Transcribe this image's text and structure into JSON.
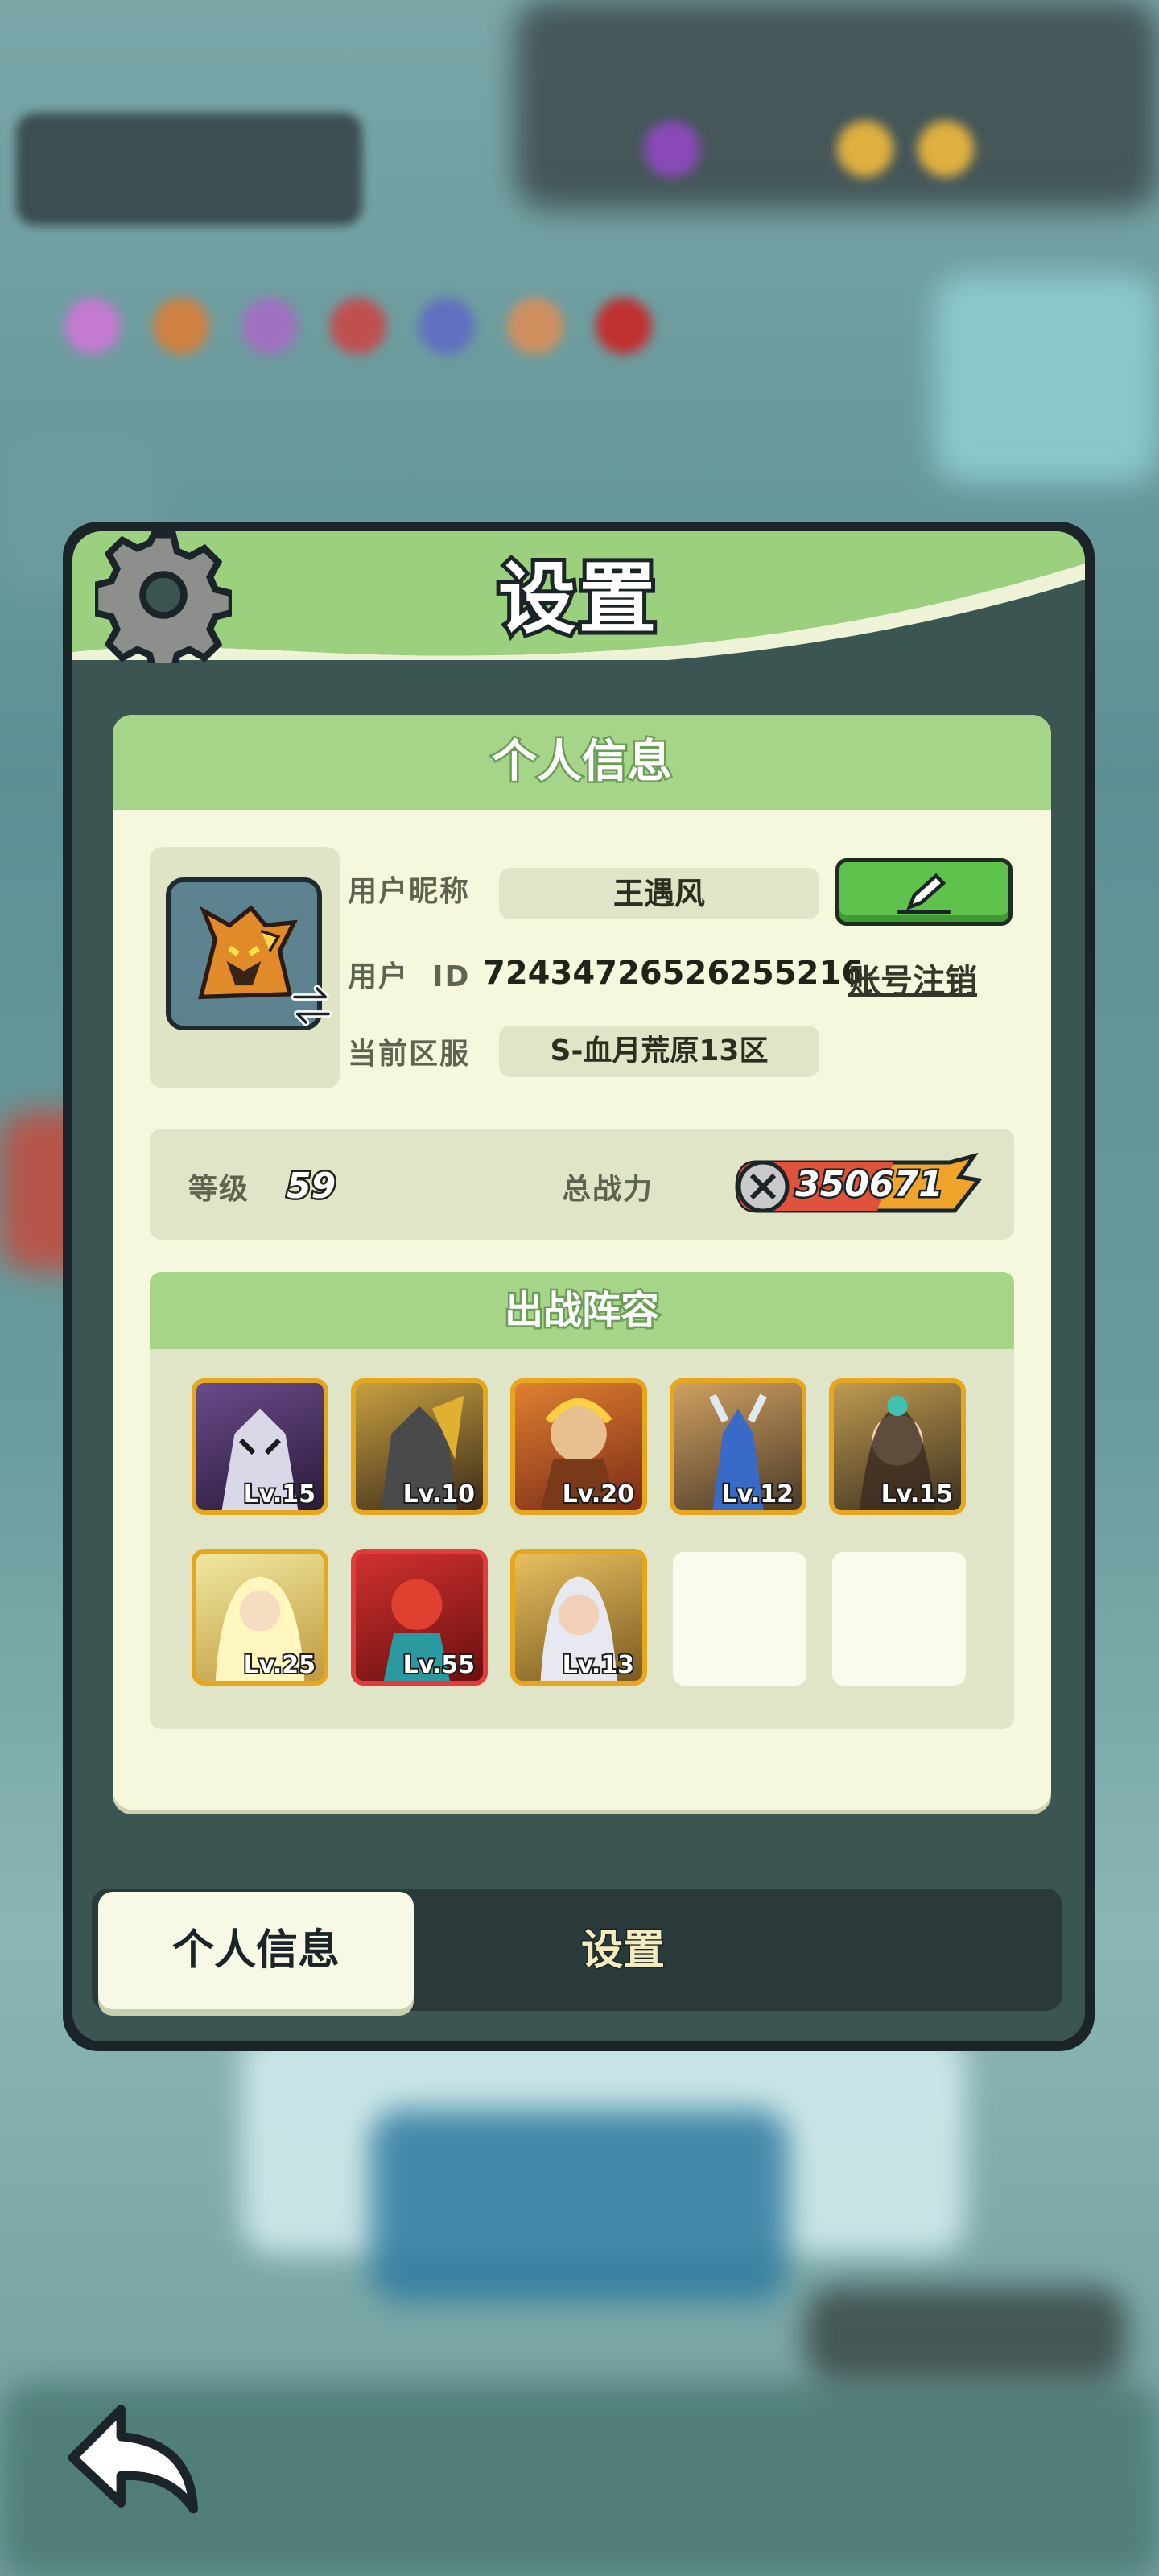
{
  "panel": {
    "title": "设置",
    "icon": "gear-icon"
  },
  "profile_section": {
    "title": "个人信息",
    "nickname_label": "用户昵称",
    "nickname": "王遇风",
    "edit_icon": "pencil-icon",
    "uid_label": "用户  ID",
    "uid": "7243472652625​5216",
    "logout_link": "账号注销",
    "server_label": "当前区服",
    "server": "S-血月荒原13区",
    "level_label": "等级",
    "level": "59",
    "power_label": "总战力",
    "power": "350671"
  },
  "team": {
    "title": "出战阵容",
    "heroes": [
      {
        "level": "Lv.15",
        "frame": "gold"
      },
      {
        "level": "Lv.10",
        "frame": "gold"
      },
      {
        "level": "Lv.20",
        "frame": "gold"
      },
      {
        "level": "Lv.12",
        "frame": "gold"
      },
      {
        "level": "Lv.15",
        "frame": "gold"
      },
      {
        "level": "Lv.25",
        "frame": "gold"
      },
      {
        "level": "Lv.55",
        "frame": "red"
      },
      {
        "level": "Lv.13",
        "frame": "gold"
      }
    ],
    "empty_slots": 2
  },
  "tabs": {
    "active": "个人信息",
    "inactive": "设置"
  },
  "colors": {
    "accent_green": "#a6d58a",
    "panel_dark": "#3b5553",
    "content_bg": "#f6f8de",
    "edit_button": "#5fc24c"
  }
}
